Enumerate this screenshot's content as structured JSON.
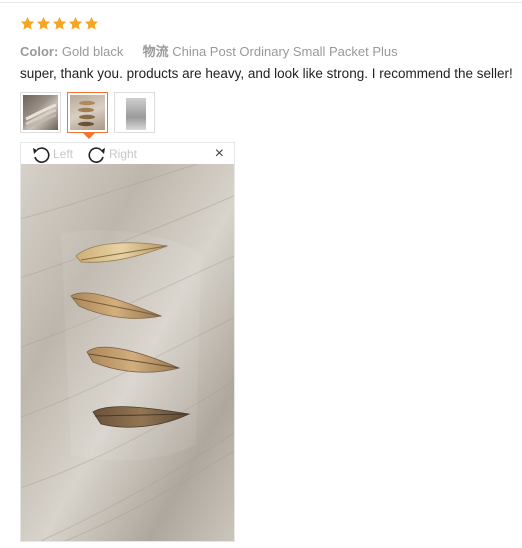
{
  "review": {
    "rating": 5,
    "rating_max": 5,
    "star_color": "#f5a623",
    "color_label": "Color:",
    "color_value": "Gold black",
    "shipping_label": "物流",
    "shipping_value": "China Post Ordinary Small Packet Plus",
    "text": "super, thank you. products are heavy, and look like strong. I recommend the seller!"
  },
  "thumbnails": [
    {
      "name": "thumb-photo-1",
      "active": false
    },
    {
      "name": "thumb-photo-2",
      "active": true
    },
    {
      "name": "thumb-photo-3",
      "active": false
    }
  ],
  "viewer": {
    "rotate_left_label": "Left",
    "rotate_right_label": "Right",
    "close_label": "×",
    "accent_color": "#f5732a"
  }
}
